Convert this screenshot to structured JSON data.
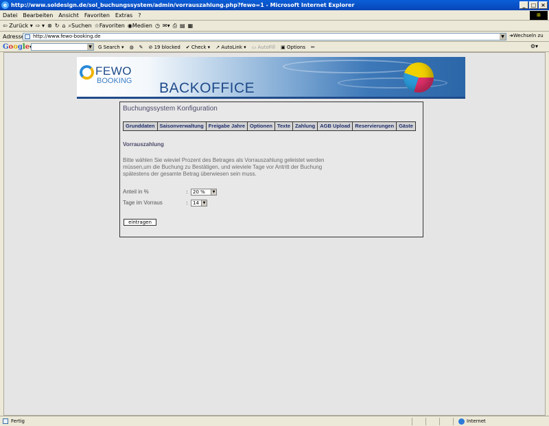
{
  "window": {
    "title": "http://www.soldesign.de/sol_buchungssystem/admin/vorrauszahlung.php?fewo=1 - Microsoft Internet Explorer"
  },
  "menu": [
    "Datei",
    "Bearbeiten",
    "Ansicht",
    "Favoriten",
    "Extras",
    "?"
  ],
  "nav": {
    "back": "Zurück",
    "search": "Suchen",
    "favorites": "Favoriten",
    "media": "Medien"
  },
  "address": {
    "label": "Adresse",
    "url": "http://www.fewo-booking.de",
    "go": "Wechseln zu"
  },
  "google_toolbar": {
    "brand": "Google",
    "search": "Search",
    "blocked": "19 blocked",
    "check": "Check",
    "autolink": "AutoLink",
    "autofill": "AutoFill",
    "options": "Options"
  },
  "banner": {
    "logo_line1": "FEWO",
    "logo_line2": "BOOKING",
    "heading": "BACKOFFICE"
  },
  "panel": {
    "title": "Buchungssystem Konfiguration",
    "tabs": [
      "Grunddaten",
      "Saisonverwaltung",
      "Freigabe Jahre",
      "Optionen",
      "Texte",
      "Zahlung",
      "AGB Upload",
      "Reservierungen",
      "Gäste"
    ],
    "section": "Vorrauszahlung",
    "description": "Bitte wählen Sie wieviel Prozent des Betrages als Vorrauszahlung geleistet werden müssen,um die Buchung zu Bestätigen, und wieviele Tage vor Antritt der Buchung spätestens der gesamte Betrag überwiesen sein muss.",
    "fields": [
      {
        "label": "Anteil in %",
        "value": "20 %"
      },
      {
        "label": "Tage im Vorraus",
        "value": "14"
      }
    ],
    "submit": "eintragen"
  },
  "status": {
    "left": "Fertig",
    "zone": "Internet"
  }
}
